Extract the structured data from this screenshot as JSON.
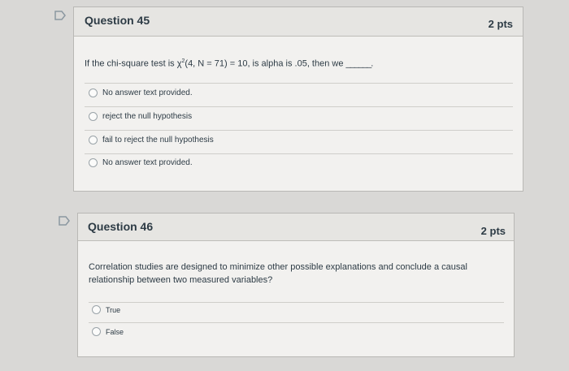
{
  "q45": {
    "title": "Question 45",
    "points": "2 pts",
    "text_before": "If the chi-square test is χ",
    "text_sup": "2",
    "text_after": "(4, N = 71) = 10, is alpha is .05, then we ",
    "text_blank": "______.",
    "options": [
      {
        "label": "No answer text provided."
      },
      {
        "label": "reject the null hypothesis"
      },
      {
        "label": "fail to reject the null hypothesis"
      },
      {
        "label": "No answer text provided."
      }
    ]
  },
  "q46": {
    "title": "Question 46",
    "points": "2 pts",
    "text": "Correlation studies are designed to minimize other possible explanations and conclude a causal relationship between two measured variables?",
    "options": [
      {
        "label": "True"
      },
      {
        "label": "False"
      }
    ]
  },
  "colors": {
    "background": "#d9d8d6",
    "card": "#f2f1ef",
    "header": "#e6e5e2",
    "text": "#2d3b45"
  }
}
